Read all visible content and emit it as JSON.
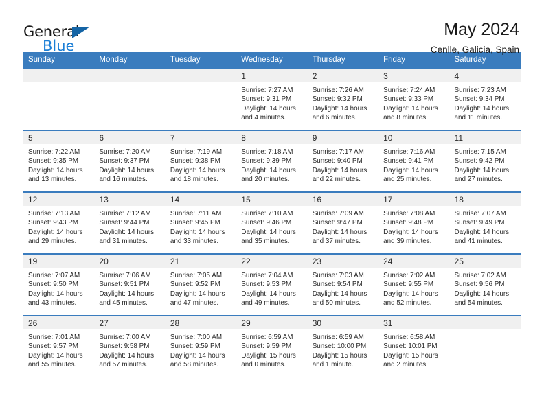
{
  "brand": {
    "name_top": "General",
    "name_bottom": "Blue",
    "triangle_color": "#1464a5",
    "blue_color": "#1c7fd6"
  },
  "header": {
    "title": "May 2024",
    "location": "Cenlle, Galicia, Spain"
  },
  "theme": {
    "header_row_bg": "#3a7cbe",
    "daynum_bg": "#f0f0f0",
    "cell_border": "#3a7cbe",
    "text": "#2b2b2b"
  },
  "weekday_headers": [
    "Sunday",
    "Monday",
    "Tuesday",
    "Wednesday",
    "Thursday",
    "Friday",
    "Saturday"
  ],
  "weeks": [
    [
      {
        "day": "",
        "sunrise": "",
        "sunset": "",
        "daylight_line1": "",
        "daylight_line2": ""
      },
      {
        "day": "",
        "sunrise": "",
        "sunset": "",
        "daylight_line1": "",
        "daylight_line2": ""
      },
      {
        "day": "",
        "sunrise": "",
        "sunset": "",
        "daylight_line1": "",
        "daylight_line2": ""
      },
      {
        "day": "1",
        "sunrise": "Sunrise: 7:27 AM",
        "sunset": "Sunset: 9:31 PM",
        "daylight_line1": "Daylight: 14 hours",
        "daylight_line2": "and 4 minutes."
      },
      {
        "day": "2",
        "sunrise": "Sunrise: 7:26 AM",
        "sunset": "Sunset: 9:32 PM",
        "daylight_line1": "Daylight: 14 hours",
        "daylight_line2": "and 6 minutes."
      },
      {
        "day": "3",
        "sunrise": "Sunrise: 7:24 AM",
        "sunset": "Sunset: 9:33 PM",
        "daylight_line1": "Daylight: 14 hours",
        "daylight_line2": "and 8 minutes."
      },
      {
        "day": "4",
        "sunrise": "Sunrise: 7:23 AM",
        "sunset": "Sunset: 9:34 PM",
        "daylight_line1": "Daylight: 14 hours",
        "daylight_line2": "and 11 minutes."
      }
    ],
    [
      {
        "day": "5",
        "sunrise": "Sunrise: 7:22 AM",
        "sunset": "Sunset: 9:35 PM",
        "daylight_line1": "Daylight: 14 hours",
        "daylight_line2": "and 13 minutes."
      },
      {
        "day": "6",
        "sunrise": "Sunrise: 7:20 AM",
        "sunset": "Sunset: 9:37 PM",
        "daylight_line1": "Daylight: 14 hours",
        "daylight_line2": "and 16 minutes."
      },
      {
        "day": "7",
        "sunrise": "Sunrise: 7:19 AM",
        "sunset": "Sunset: 9:38 PM",
        "daylight_line1": "Daylight: 14 hours",
        "daylight_line2": "and 18 minutes."
      },
      {
        "day": "8",
        "sunrise": "Sunrise: 7:18 AM",
        "sunset": "Sunset: 9:39 PM",
        "daylight_line1": "Daylight: 14 hours",
        "daylight_line2": "and 20 minutes."
      },
      {
        "day": "9",
        "sunrise": "Sunrise: 7:17 AM",
        "sunset": "Sunset: 9:40 PM",
        "daylight_line1": "Daylight: 14 hours",
        "daylight_line2": "and 22 minutes."
      },
      {
        "day": "10",
        "sunrise": "Sunrise: 7:16 AM",
        "sunset": "Sunset: 9:41 PM",
        "daylight_line1": "Daylight: 14 hours",
        "daylight_line2": "and 25 minutes."
      },
      {
        "day": "11",
        "sunrise": "Sunrise: 7:15 AM",
        "sunset": "Sunset: 9:42 PM",
        "daylight_line1": "Daylight: 14 hours",
        "daylight_line2": "and 27 minutes."
      }
    ],
    [
      {
        "day": "12",
        "sunrise": "Sunrise: 7:13 AM",
        "sunset": "Sunset: 9:43 PM",
        "daylight_line1": "Daylight: 14 hours",
        "daylight_line2": "and 29 minutes."
      },
      {
        "day": "13",
        "sunrise": "Sunrise: 7:12 AM",
        "sunset": "Sunset: 9:44 PM",
        "daylight_line1": "Daylight: 14 hours",
        "daylight_line2": "and 31 minutes."
      },
      {
        "day": "14",
        "sunrise": "Sunrise: 7:11 AM",
        "sunset": "Sunset: 9:45 PM",
        "daylight_line1": "Daylight: 14 hours",
        "daylight_line2": "and 33 minutes."
      },
      {
        "day": "15",
        "sunrise": "Sunrise: 7:10 AM",
        "sunset": "Sunset: 9:46 PM",
        "daylight_line1": "Daylight: 14 hours",
        "daylight_line2": "and 35 minutes."
      },
      {
        "day": "16",
        "sunrise": "Sunrise: 7:09 AM",
        "sunset": "Sunset: 9:47 PM",
        "daylight_line1": "Daylight: 14 hours",
        "daylight_line2": "and 37 minutes."
      },
      {
        "day": "17",
        "sunrise": "Sunrise: 7:08 AM",
        "sunset": "Sunset: 9:48 PM",
        "daylight_line1": "Daylight: 14 hours",
        "daylight_line2": "and 39 minutes."
      },
      {
        "day": "18",
        "sunrise": "Sunrise: 7:07 AM",
        "sunset": "Sunset: 9:49 PM",
        "daylight_line1": "Daylight: 14 hours",
        "daylight_line2": "and 41 minutes."
      }
    ],
    [
      {
        "day": "19",
        "sunrise": "Sunrise: 7:07 AM",
        "sunset": "Sunset: 9:50 PM",
        "daylight_line1": "Daylight: 14 hours",
        "daylight_line2": "and 43 minutes."
      },
      {
        "day": "20",
        "sunrise": "Sunrise: 7:06 AM",
        "sunset": "Sunset: 9:51 PM",
        "daylight_line1": "Daylight: 14 hours",
        "daylight_line2": "and 45 minutes."
      },
      {
        "day": "21",
        "sunrise": "Sunrise: 7:05 AM",
        "sunset": "Sunset: 9:52 PM",
        "daylight_line1": "Daylight: 14 hours",
        "daylight_line2": "and 47 minutes."
      },
      {
        "day": "22",
        "sunrise": "Sunrise: 7:04 AM",
        "sunset": "Sunset: 9:53 PM",
        "daylight_line1": "Daylight: 14 hours",
        "daylight_line2": "and 49 minutes."
      },
      {
        "day": "23",
        "sunrise": "Sunrise: 7:03 AM",
        "sunset": "Sunset: 9:54 PM",
        "daylight_line1": "Daylight: 14 hours",
        "daylight_line2": "and 50 minutes."
      },
      {
        "day": "24",
        "sunrise": "Sunrise: 7:02 AM",
        "sunset": "Sunset: 9:55 PM",
        "daylight_line1": "Daylight: 14 hours",
        "daylight_line2": "and 52 minutes."
      },
      {
        "day": "25",
        "sunrise": "Sunrise: 7:02 AM",
        "sunset": "Sunset: 9:56 PM",
        "daylight_line1": "Daylight: 14 hours",
        "daylight_line2": "and 54 minutes."
      }
    ],
    [
      {
        "day": "26",
        "sunrise": "Sunrise: 7:01 AM",
        "sunset": "Sunset: 9:57 PM",
        "daylight_line1": "Daylight: 14 hours",
        "daylight_line2": "and 55 minutes."
      },
      {
        "day": "27",
        "sunrise": "Sunrise: 7:00 AM",
        "sunset": "Sunset: 9:58 PM",
        "daylight_line1": "Daylight: 14 hours",
        "daylight_line2": "and 57 minutes."
      },
      {
        "day": "28",
        "sunrise": "Sunrise: 7:00 AM",
        "sunset": "Sunset: 9:59 PM",
        "daylight_line1": "Daylight: 14 hours",
        "daylight_line2": "and 58 minutes."
      },
      {
        "day": "29",
        "sunrise": "Sunrise: 6:59 AM",
        "sunset": "Sunset: 9:59 PM",
        "daylight_line1": "Daylight: 15 hours",
        "daylight_line2": "and 0 minutes."
      },
      {
        "day": "30",
        "sunrise": "Sunrise: 6:59 AM",
        "sunset": "Sunset: 10:00 PM",
        "daylight_line1": "Daylight: 15 hours",
        "daylight_line2": "and 1 minute."
      },
      {
        "day": "31",
        "sunrise": "Sunrise: 6:58 AM",
        "sunset": "Sunset: 10:01 PM",
        "daylight_line1": "Daylight: 15 hours",
        "daylight_line2": "and 2 minutes."
      },
      {
        "day": "",
        "sunrise": "",
        "sunset": "",
        "daylight_line1": "",
        "daylight_line2": ""
      }
    ]
  ]
}
